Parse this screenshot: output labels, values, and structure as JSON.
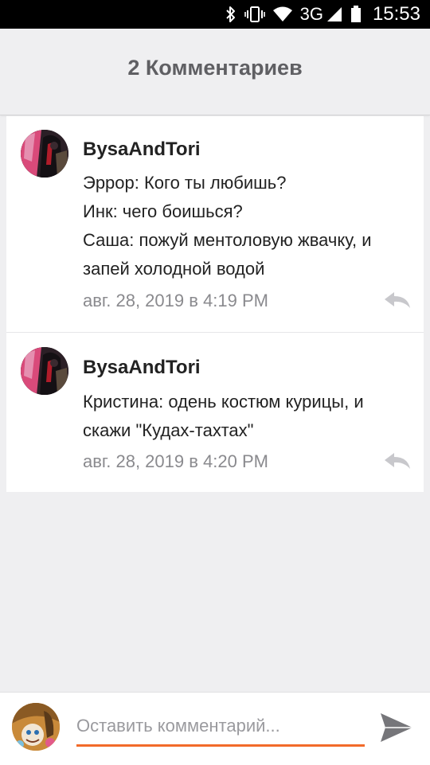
{
  "status_bar": {
    "network": "3G",
    "time": "15:53",
    "icons": [
      "bluetooth-icon",
      "vibrate-icon",
      "wifi-icon",
      "signal-icon",
      "battery-icon"
    ]
  },
  "header": {
    "title": "2 Комментариев"
  },
  "comments": [
    {
      "author": "BysaAndTori",
      "lines": [
        "Эррор: Кого ты любишь?",
        "Инк: чего боишься?",
        "Саша: пожуй ментоловую жвачку, и",
        "запей холодной водой"
      ],
      "timestamp": "авг. 28, 2019 в 4:19 PM",
      "reply_icon": "reply-icon"
    },
    {
      "author": "BysaAndTori",
      "lines": [
        "Кристина: одень костюм курицы, и",
        "скажи \"Кудах-тахтах\""
      ],
      "timestamp": "авг. 28, 2019 в 4:20 PM",
      "reply_icon": "reply-icon"
    }
  ],
  "composer": {
    "placeholder": "Оставить комментарий...",
    "value": "",
    "send_icon": "send-icon"
  },
  "colors": {
    "accent": "#f26b2a",
    "background": "#efeff1",
    "header_text": "#5f5f63",
    "meta_text": "#8a8a8e"
  }
}
